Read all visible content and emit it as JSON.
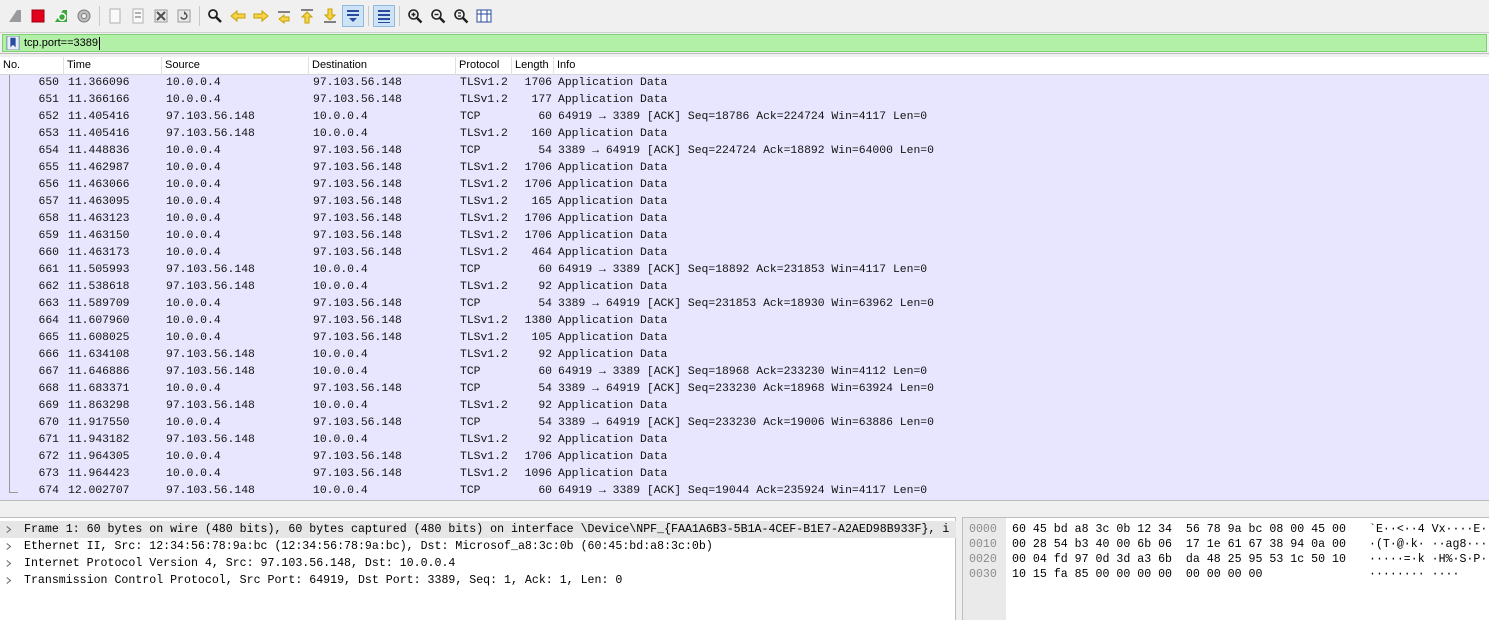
{
  "toolbar": {
    "buttons": [
      {
        "name": "start-capture-icon",
        "color": "#9a9a9a"
      },
      {
        "name": "stop-capture-icon",
        "color": "#e0001b"
      },
      {
        "name": "restart-capture-icon",
        "color": "#3aa83a"
      },
      {
        "name": "capture-options-icon",
        "color": "#7a7a7a"
      },
      {
        "name": "open-file-icon",
        "color": "#b0b0b0"
      },
      {
        "name": "save-file-icon",
        "color": "#b0b0b0"
      },
      {
        "name": "close-file-icon",
        "color": "#707070"
      },
      {
        "name": "reload-file-icon",
        "color": "#808080"
      },
      {
        "name": "find-packet-icon",
        "color": "#202020"
      },
      {
        "name": "go-back-icon",
        "color": "#c9a100"
      },
      {
        "name": "go-forward-icon",
        "color": "#c9a100"
      },
      {
        "name": "go-to-packet-icon",
        "color": "#c9a100"
      },
      {
        "name": "go-first-packet-icon",
        "color": "#c9a100"
      },
      {
        "name": "go-last-packet-icon",
        "color": "#c9a100"
      },
      {
        "name": "auto-scroll-icon",
        "color": "#2a4aa0"
      },
      {
        "name": "colorize-icon",
        "color": "#2a4aa0"
      },
      {
        "name": "zoom-in-icon",
        "color": "#202020"
      },
      {
        "name": "zoom-out-icon",
        "color": "#202020"
      },
      {
        "name": "normal-size-icon",
        "color": "#202020"
      },
      {
        "name": "resize-columns-icon",
        "color": "#2a4aa0"
      }
    ]
  },
  "filter": {
    "value": "tcp.port==3389",
    "bg_color": "#b1f0a6",
    "icon": "bookmark-icon"
  },
  "packet_list": {
    "columns": {
      "no": "No.",
      "time": "Time",
      "source": "Source",
      "destination": "Destination",
      "protocol": "Protocol",
      "length": "Length",
      "info": "Info"
    },
    "row_color": "#e7e6fe",
    "rows": [
      {
        "no": "650",
        "time": "11.366096",
        "src": "10.0.0.4",
        "dst": "97.103.56.148",
        "proto": "TLSv1.2",
        "len": "1706",
        "info": "Application Data"
      },
      {
        "no": "651",
        "time": "11.366166",
        "src": "10.0.0.4",
        "dst": "97.103.56.148",
        "proto": "TLSv1.2",
        "len": "177",
        "info": "Application Data"
      },
      {
        "no": "652",
        "time": "11.405416",
        "src": "97.103.56.148",
        "dst": "10.0.0.4",
        "proto": "TCP",
        "len": "60",
        "info": "64919 → 3389 [ACK] Seq=18786 Ack=224724 Win=4117 Len=0"
      },
      {
        "no": "653",
        "time": "11.405416",
        "src": "97.103.56.148",
        "dst": "10.0.0.4",
        "proto": "TLSv1.2",
        "len": "160",
        "info": "Application Data"
      },
      {
        "no": "654",
        "time": "11.448836",
        "src": "10.0.0.4",
        "dst": "97.103.56.148",
        "proto": "TCP",
        "len": "54",
        "info": "3389 → 64919 [ACK] Seq=224724 Ack=18892 Win=64000 Len=0"
      },
      {
        "no": "655",
        "time": "11.462987",
        "src": "10.0.0.4",
        "dst": "97.103.56.148",
        "proto": "TLSv1.2",
        "len": "1706",
        "info": "Application Data"
      },
      {
        "no": "656",
        "time": "11.463066",
        "src": "10.0.0.4",
        "dst": "97.103.56.148",
        "proto": "TLSv1.2",
        "len": "1706",
        "info": "Application Data"
      },
      {
        "no": "657",
        "time": "11.463095",
        "src": "10.0.0.4",
        "dst": "97.103.56.148",
        "proto": "TLSv1.2",
        "len": "165",
        "info": "Application Data"
      },
      {
        "no": "658",
        "time": "11.463123",
        "src": "10.0.0.4",
        "dst": "97.103.56.148",
        "proto": "TLSv1.2",
        "len": "1706",
        "info": "Application Data"
      },
      {
        "no": "659",
        "time": "11.463150",
        "src": "10.0.0.4",
        "dst": "97.103.56.148",
        "proto": "TLSv1.2",
        "len": "1706",
        "info": "Application Data"
      },
      {
        "no": "660",
        "time": "11.463173",
        "src": "10.0.0.4",
        "dst": "97.103.56.148",
        "proto": "TLSv1.2",
        "len": "464",
        "info": "Application Data"
      },
      {
        "no": "661",
        "time": "11.505993",
        "src": "97.103.56.148",
        "dst": "10.0.0.4",
        "proto": "TCP",
        "len": "60",
        "info": "64919 → 3389 [ACK] Seq=18892 Ack=231853 Win=4117 Len=0"
      },
      {
        "no": "662",
        "time": "11.538618",
        "src": "97.103.56.148",
        "dst": "10.0.0.4",
        "proto": "TLSv1.2",
        "len": "92",
        "info": "Application Data"
      },
      {
        "no": "663",
        "time": "11.589709",
        "src": "10.0.0.4",
        "dst": "97.103.56.148",
        "proto": "TCP",
        "len": "54",
        "info": "3389 → 64919 [ACK] Seq=231853 Ack=18930 Win=63962 Len=0"
      },
      {
        "no": "664",
        "time": "11.607960",
        "src": "10.0.0.4",
        "dst": "97.103.56.148",
        "proto": "TLSv1.2",
        "len": "1380",
        "info": "Application Data"
      },
      {
        "no": "665",
        "time": "11.608025",
        "src": "10.0.0.4",
        "dst": "97.103.56.148",
        "proto": "TLSv1.2",
        "len": "105",
        "info": "Application Data"
      },
      {
        "no": "666",
        "time": "11.634108",
        "src": "97.103.56.148",
        "dst": "10.0.0.4",
        "proto": "TLSv1.2",
        "len": "92",
        "info": "Application Data"
      },
      {
        "no": "667",
        "time": "11.646886",
        "src": "97.103.56.148",
        "dst": "10.0.0.4",
        "proto": "TCP",
        "len": "60",
        "info": "64919 → 3389 [ACK] Seq=18968 Ack=233230 Win=4112 Len=0"
      },
      {
        "no": "668",
        "time": "11.683371",
        "src": "10.0.0.4",
        "dst": "97.103.56.148",
        "proto": "TCP",
        "len": "54",
        "info": "3389 → 64919 [ACK] Seq=233230 Ack=18968 Win=63924 Len=0"
      },
      {
        "no": "669",
        "time": "11.863298",
        "src": "97.103.56.148",
        "dst": "10.0.0.4",
        "proto": "TLSv1.2",
        "len": "92",
        "info": "Application Data"
      },
      {
        "no": "670",
        "time": "11.917550",
        "src": "10.0.0.4",
        "dst": "97.103.56.148",
        "proto": "TCP",
        "len": "54",
        "info": "3389 → 64919 [ACK] Seq=233230 Ack=19006 Win=63886 Len=0"
      },
      {
        "no": "671",
        "time": "11.943182",
        "src": "97.103.56.148",
        "dst": "10.0.0.4",
        "proto": "TLSv1.2",
        "len": "92",
        "info": "Application Data"
      },
      {
        "no": "672",
        "time": "11.964305",
        "src": "10.0.0.4",
        "dst": "97.103.56.148",
        "proto": "TLSv1.2",
        "len": "1706",
        "info": "Application Data"
      },
      {
        "no": "673",
        "time": "11.964423",
        "src": "10.0.0.4",
        "dst": "97.103.56.148",
        "proto": "TLSv1.2",
        "len": "1096",
        "info": "Application Data"
      },
      {
        "no": "674",
        "time": "12.002707",
        "src": "97.103.56.148",
        "dst": "10.0.0.4",
        "proto": "TCP",
        "len": "60",
        "info": "64919 → 3389 [ACK] Seq=19044 Ack=235924 Win=4117 Len=0"
      }
    ]
  },
  "details": {
    "rows": [
      "Frame 1: 60 bytes on wire (480 bits), 60 bytes captured (480 bits) on interface \\Device\\NPF_{FAA1A6B3-5B1A-4CEF-B1E7-A2AED98B933F}, i",
      "Ethernet II, Src: 12:34:56:78:9a:bc (12:34:56:78:9a:bc), Dst: Microsof_a8:3c:0b (60:45:bd:a8:3c:0b)",
      "Internet Protocol Version 4, Src: 97.103.56.148, Dst: 10.0.0.4",
      "Transmission Control Protocol, Src Port: 64919, Dst Port: 3389, Seq: 1, Ack: 1, Len: 0"
    ]
  },
  "bytes": {
    "rows": [
      {
        "offset": "0000",
        "hex": "60 45 bd a8 3c 0b 12 34  56 78 9a bc 08 00 45 00",
        "ascii": "`E··<··4 Vx····E·"
      },
      {
        "offset": "0010",
        "hex": "00 28 54 b3 40 00 6b 06  17 1e 61 67 38 94 0a 00",
        "ascii": "·(T·@·k· ··ag8···"
      },
      {
        "offset": "0020",
        "hex": "00 04 fd 97 0d 3d a3 6b  da 48 25 95 53 1c 50 10",
        "ascii": "·····=·k ·H%·S·P·"
      },
      {
        "offset": "0030",
        "hex": "10 15 fa 85 00 00 00 00  00 00 00 00",
        "ascii": "········ ····"
      }
    ]
  }
}
